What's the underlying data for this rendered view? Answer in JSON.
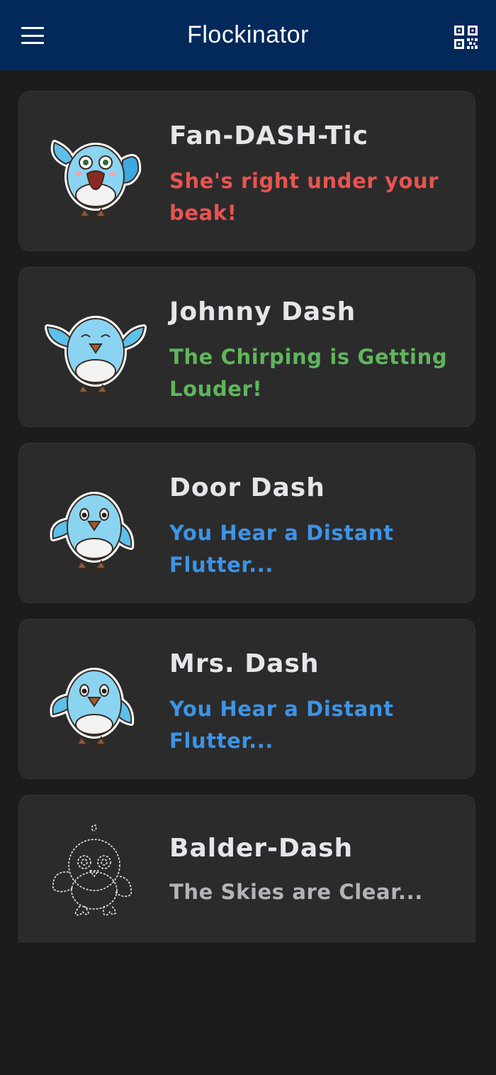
{
  "app": {
    "title": "Flockinator",
    "menu_icon": "hamburger-menu-icon",
    "qr_icon": "qr-code-icon"
  },
  "colors": {
    "appbar": "#03295b",
    "background": "#1c1c1c",
    "card": "#2b2b2b",
    "name": "#e6e6ea",
    "status_red": "#e95350",
    "status_green": "#5fb65c",
    "status_blue": "#3c94e6",
    "status_gray": "#b4b4b8"
  },
  "birds": [
    {
      "name": "Fan-DASH-Tic",
      "status": "She's right under your beak!",
      "status_color": "#e95350",
      "avatar": "excited-bird-icon"
    },
    {
      "name": "Johnny Dash",
      "status": "The Chirping is Getting Louder!",
      "status_color": "#5fb65c",
      "avatar": "happy-bird-icon"
    },
    {
      "name": "Door Dash",
      "status": "You Hear a Distant Flutter...",
      "status_color": "#3c94e6",
      "avatar": "bird-icon"
    },
    {
      "name": "Mrs. Dash",
      "status": "You Hear a Distant Flutter...",
      "status_color": "#3c94e6",
      "avatar": "bird-icon"
    },
    {
      "name": "Balder-Dash",
      "status": "The Skies are Clear...",
      "status_color": "#b4b4b8",
      "avatar": "bird-outline-icon"
    }
  ]
}
